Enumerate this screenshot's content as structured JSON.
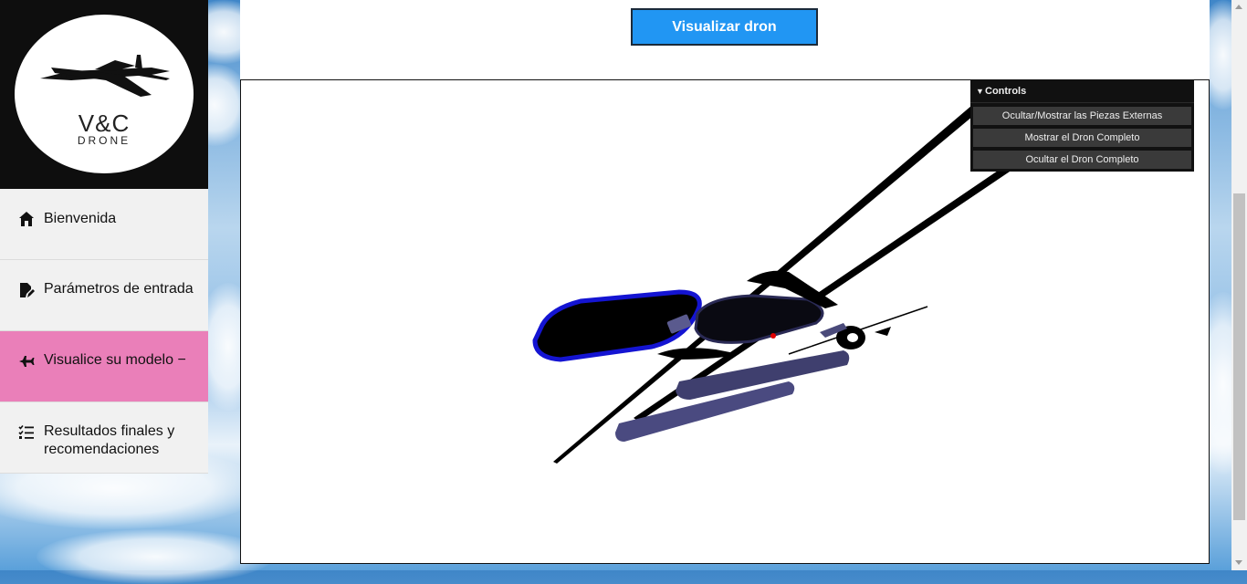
{
  "logo": {
    "line1": "V&C",
    "line2": "DRONE"
  },
  "nav": {
    "items": [
      {
        "label": "Bienvenida",
        "icon": "home-icon"
      },
      {
        "label": "Parámetros de entrada",
        "icon": "file-edit-icon"
      },
      {
        "label": "Visualice su modelo −",
        "icon": "airplane-icon"
      },
      {
        "label": "Resultados finales y recomendaciones",
        "icon": "checklist-icon"
      }
    ],
    "active_color": "#ea7fb9"
  },
  "header": {
    "visualize_button": "Visualizar dron",
    "button_color": "#2196f3"
  },
  "controls": {
    "title": "Controls",
    "buttons": [
      "Ocultar/Mostrar las Piezas Externas",
      "Mostrar el Dron Completo",
      "Ocultar el Dron Completo"
    ]
  }
}
